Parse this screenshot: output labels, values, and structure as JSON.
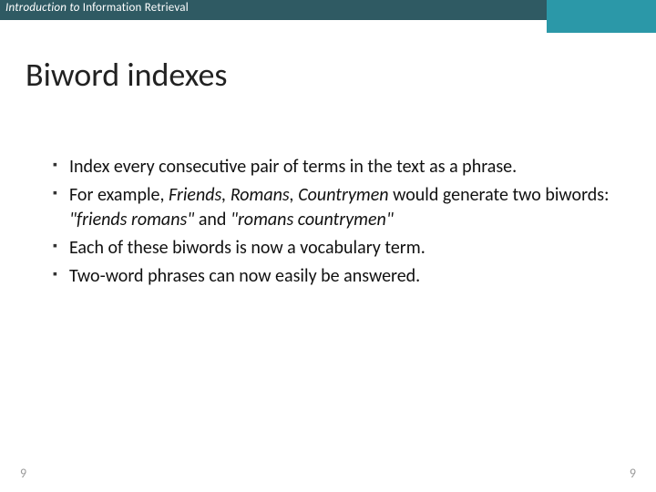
{
  "header": {
    "prefix": "Introduction to ",
    "chapter": "Information Retrieval"
  },
  "title": "Biword indexes",
  "bullets": {
    "b1": "Index every consecutive pair of terms in the text as a phrase.",
    "b2a": "For example, ",
    "b2b_italic": "Friends, Romans, Countrymen",
    "b2c": " would generate two biwords: ",
    "b2d_italic": "\"friends romans\"",
    "b2e": " and ",
    "b2f_italic": "\"romans countrymen\"",
    "b3": "Each of these biwords is now a vocabulary term.",
    "b4": "Two-word phrases can now easily be answered."
  },
  "footer": {
    "left": "9",
    "right": "9"
  }
}
